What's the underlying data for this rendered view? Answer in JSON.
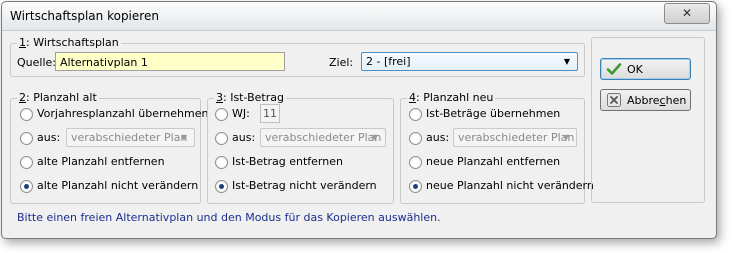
{
  "window": {
    "title": "Wirtschaftsplan kopieren",
    "close_glyph": "✕"
  },
  "wirtschaftsplan_group": {
    "legend_key": "1",
    "legend_rest": ": Wirtschaftsplan",
    "quelle_label": "Quelle:",
    "quelle_value": "Alternativplan 1",
    "ziel_label": "Ziel:",
    "ziel_value": "2 - [frei]"
  },
  "planzahl_alt": {
    "legend_key": "2",
    "legend_rest": ": Planzahl alt",
    "options": [
      {
        "label": "Vorjahresplanzahl übernehmen",
        "checked": false
      },
      {
        "label": "aus:",
        "checked": false,
        "combo": "verabschiedeter Plan"
      },
      {
        "label": "alte Planzahl entfernen",
        "checked": false
      },
      {
        "label": "alte Planzahl nicht verändern",
        "checked": true
      }
    ]
  },
  "ist_betrag": {
    "legend_key": "3",
    "legend_rest": ": Ist-Betrag",
    "options": [
      {
        "label": "WJ:",
        "checked": false,
        "value": "11"
      },
      {
        "label": "aus:",
        "checked": false,
        "combo": "verabschiedeter Plan"
      },
      {
        "label": "Ist-Betrag entfernen",
        "checked": false
      },
      {
        "label": "Ist-Betrag nicht verändern",
        "checked": true
      }
    ]
  },
  "planzahl_neu": {
    "legend_key": "4",
    "legend_rest": ": Planzahl neu",
    "options": [
      {
        "label": "Ist-Beträge übernehmen",
        "checked": false
      },
      {
        "label": "aus:",
        "checked": false,
        "combo": "verabschiedeter Plan"
      },
      {
        "label": "neue Planzahl entfernen",
        "checked": false
      },
      {
        "label": "neue Planzahl nicht verändern",
        "checked": true
      }
    ]
  },
  "buttons": {
    "ok_label": "OK",
    "abbrechen_pre": "Abbre",
    "abbrechen_key": "c",
    "abbrechen_post": "hen"
  },
  "status_text": "Bitte einen freien Alternativplan und den Modus für das Kopieren auswählen.",
  "combo_arrow_glyph": "▼",
  "icons": {
    "ok": "checkmark-icon",
    "cancel": "cancel-x-icon"
  },
  "colors": {
    "field_bg": "#ffffc8",
    "status_text": "#1a2f8f",
    "ok_check": "#3a9a2a"
  }
}
